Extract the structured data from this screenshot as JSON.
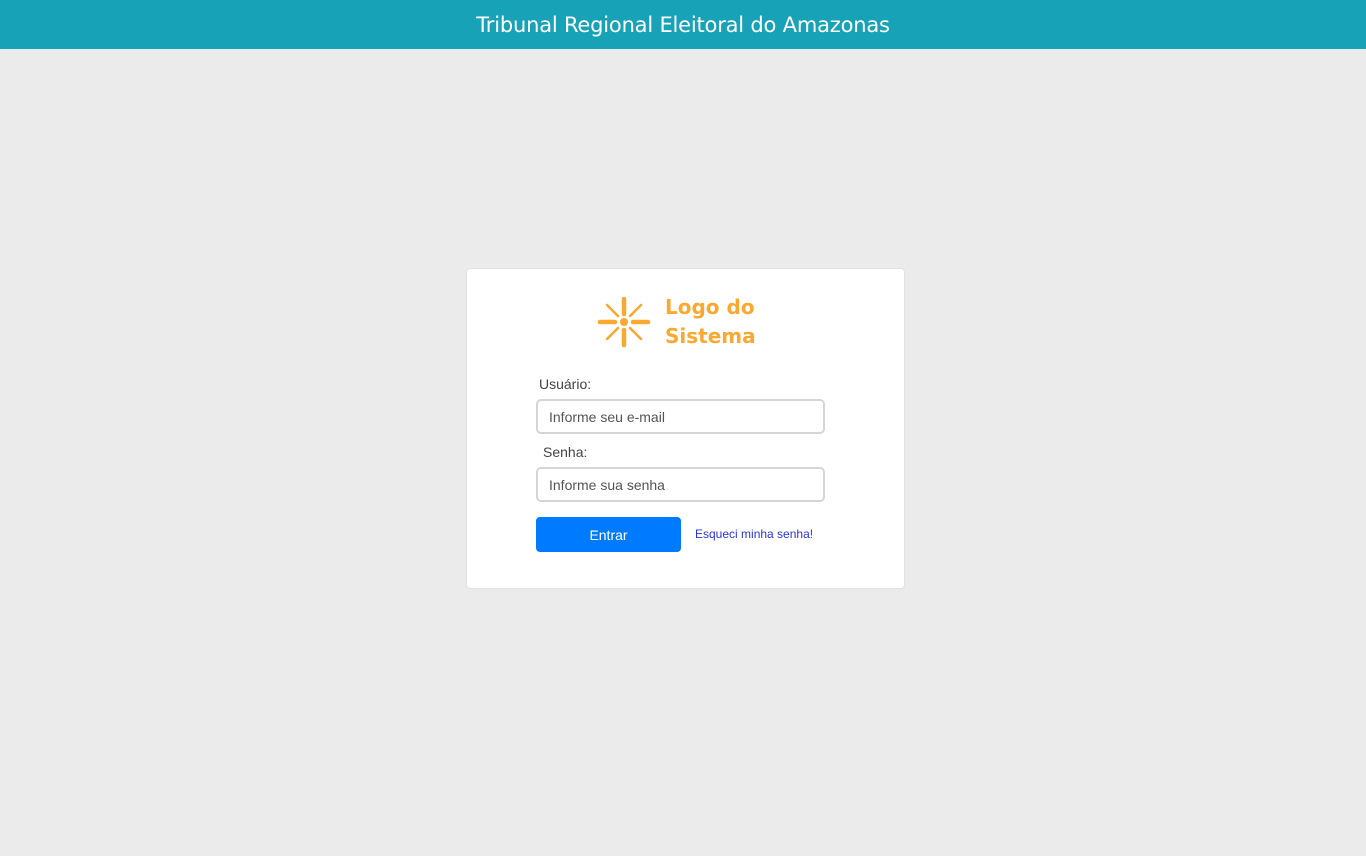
{
  "header": {
    "title": "Tribunal Regional Eleitoral do Amazonas",
    "background_color": "#17a2b8"
  },
  "login": {
    "logo": {
      "icon": "sunburst-logo-icon",
      "line1": "Logo do",
      "line2": "Sistema",
      "color": "#f9a831"
    },
    "username": {
      "label": "Usuário:",
      "placeholder": "Informe seu e-mail",
      "value": ""
    },
    "password": {
      "label": "Senha:",
      "placeholder": "Informe sua senha",
      "value": ""
    },
    "submit_label": "Entrar",
    "submit_color": "#007bff",
    "forgot_label": "Esqueci minha senha!"
  }
}
